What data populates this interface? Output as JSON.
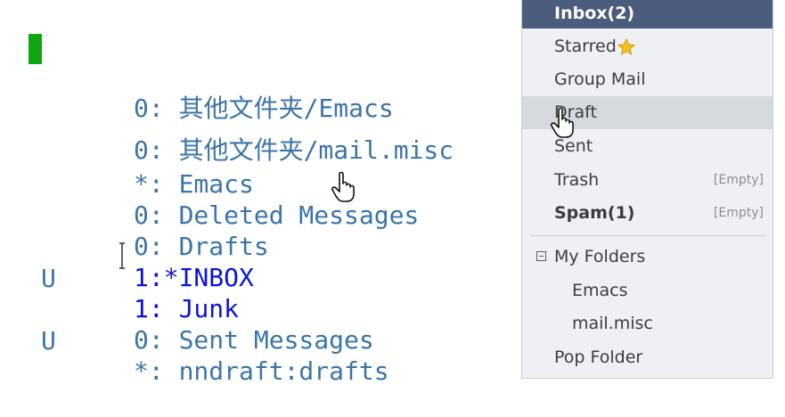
{
  "gnus": {
    "groups": [
      {
        "mark": "",
        "label": "0: 其他文件夹/Emacs",
        "unread": false
      },
      {
        "mark": "",
        "label": "0: 其他文件夹/mail.misc",
        "unread": false
      },
      {
        "mark": "",
        "label": "*: Emacs",
        "unread": false
      },
      {
        "mark": "",
        "label": "0: Deleted Messages",
        "unread": false
      },
      {
        "mark": "",
        "label": "0: Drafts",
        "unread": false
      },
      {
        "mark": "",
        "label": "1:*INBOX",
        "unread": true
      },
      {
        "mark": "U",
        "label": "1: Junk",
        "unread": true
      },
      {
        "mark": "",
        "label": "0: Sent Messages",
        "unread": false
      },
      {
        "mark": "U",
        "label": "*: nndraft:drafts",
        "unread": false
      }
    ]
  },
  "folders": {
    "inbox": "Inbox(2)",
    "starred": "Starred",
    "group_mail": "Group Mail",
    "draft": "Draft",
    "sent": "Sent",
    "trash": "Trash",
    "trash_status": "[Empty]",
    "spam": "Spam(1)",
    "spam_status": "[Empty]",
    "my_folders": "My Folders",
    "emacs": "Emacs",
    "mail_misc": "mail.misc",
    "pop_folder": "Pop Folder"
  },
  "colors": {
    "gnus_read": "#3b74a8",
    "gnus_unread": "#0a14d6",
    "cursor": "#12a512",
    "active_folder": "#4b5c7d"
  },
  "icons": {
    "cursor": "text-cursor-icon",
    "pointer": "hand-pointer-icon",
    "star": "star-icon",
    "collapse": "collapse-icon"
  }
}
